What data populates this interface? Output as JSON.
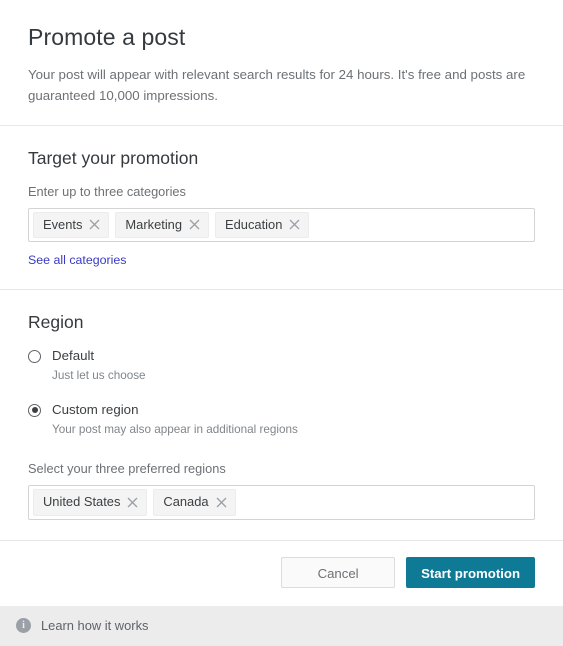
{
  "header": {
    "title": "Promote a post",
    "subtitle": "Your post will appear with relevant search results for 24 hours. It's free and posts are guaranteed 10,000 impressions."
  },
  "target_section": {
    "title": "Target your promotion",
    "field_label": "Enter up to three categories",
    "chips": [
      {
        "label": "Events",
        "remove_icon": "close-icon"
      },
      {
        "label": "Marketing",
        "remove_icon": "close-icon"
      },
      {
        "label": "Education",
        "remove_icon": "close-icon"
      }
    ],
    "link_label": "See all categories",
    "link_color": "#3a3ac4"
  },
  "region_section": {
    "title": "Region",
    "options": [
      {
        "label": "Default",
        "help": "Just let us choose",
        "selected": false
      },
      {
        "label": "Custom region",
        "help": "Your post may also appear in additional regions",
        "selected": true
      }
    ],
    "field_label": "Select your three preferred regions",
    "chips": [
      {
        "label": "United States",
        "remove_icon": "close-icon"
      },
      {
        "label": "Canada",
        "remove_icon": "close-icon"
      }
    ]
  },
  "actions": {
    "cancel_label": "Cancel",
    "primary_label": "Start promotion",
    "primary_color": "#0e7a95"
  },
  "footer": {
    "icon": "info-icon",
    "icon_glyph": "i",
    "text": "Learn how it works",
    "background": "#ececec"
  }
}
